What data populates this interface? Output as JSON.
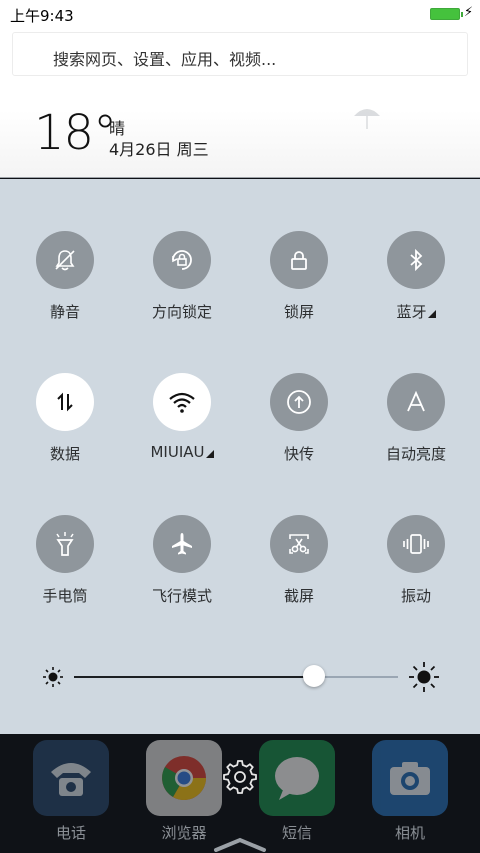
{
  "status_bar": {
    "time": "上午9:43"
  },
  "search": {
    "placeholder": "搜索网页、设置、应用、视频..."
  },
  "weather": {
    "temperature": "18°",
    "condition": "晴",
    "date": "4月26日 周三"
  },
  "toggles": [
    {
      "label": "静音",
      "icon": "bell-off-icon",
      "on": false
    },
    {
      "label": "方向锁定",
      "icon": "rotation-lock-icon",
      "on": false
    },
    {
      "label": "锁屏",
      "icon": "lock-icon",
      "on": false
    },
    {
      "label": "蓝牙",
      "icon": "bluetooth-icon",
      "on": false,
      "expandable": true
    },
    {
      "label": "数据",
      "icon": "data-arrows-icon",
      "on": true
    },
    {
      "label": "MIUIAU",
      "icon": "wifi-icon",
      "on": true,
      "expandable": true
    },
    {
      "label": "快传",
      "icon": "upload-circle-icon",
      "on": false
    },
    {
      "label": "自动亮度",
      "icon": "auto-brightness-icon",
      "on": false
    },
    {
      "label": "手电筒",
      "icon": "flashlight-icon",
      "on": false
    },
    {
      "label": "飞行模式",
      "icon": "airplane-icon",
      "on": false
    },
    {
      "label": "截屏",
      "icon": "scissors-icon",
      "on": false
    },
    {
      "label": "振动",
      "icon": "vibrate-icon",
      "on": false
    }
  ],
  "brightness": {
    "level": 0.74
  },
  "dock": {
    "apps": [
      {
        "label": "电话",
        "icon": "phone-icon",
        "color": "#2b4a6e"
      },
      {
        "label": "浏览器",
        "icon": "browser-icon",
        "color": "#d9d9d9"
      },
      {
        "label": "短信",
        "icon": "message-icon",
        "color": "#1e8c4e"
      },
      {
        "label": "相机",
        "icon": "camera-icon",
        "color": "#2a6fb5"
      }
    ]
  }
}
